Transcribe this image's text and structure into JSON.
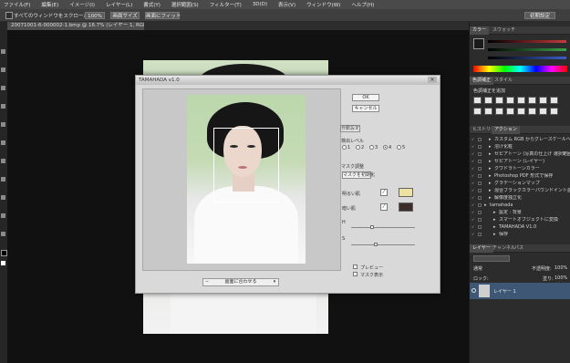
{
  "menu": [
    "ファイル(F)",
    "編集(E)",
    "イメージ(I)",
    "レイヤー(L)",
    "書式(Y)",
    "選択範囲(S)",
    "フィルター(T)",
    "3D(D)",
    "表示(V)",
    "ウィンドウ(W)",
    "ヘルプ(H)"
  ],
  "options": {
    "scroll_all": "すべてのウィンドウをスクロール",
    "zoom_100": "100%",
    "actual_pixels": "画面サイズ",
    "fit_screen": "画面にフィット",
    "workspace": "初期設定"
  },
  "document_tab": "20071001-6-000002-1.bmp @ 16.7% (レイヤー 1, RGB/8) *",
  "dialog": {
    "title": "TAMAHADA v1.0",
    "ok": "OK",
    "cancel": "キャンセル",
    "auto_set": "自動設定",
    "detect_level_label": "検出レベル",
    "detect_levels": [
      "1",
      "2",
      "3",
      "4",
      "5"
    ],
    "detect_selected_index": 3,
    "mask_adjust_label": "マスク調整",
    "mask_adjust_button": "マスクを初期化",
    "bright_label": "明るい肌",
    "dark_label": "暗い肌",
    "bright_color": "#ede2a1",
    "dark_color": "#3d2d2a",
    "h_label": "H",
    "s_label": "S",
    "preview_label": "プレビュー",
    "mask_display_label": "マスク表示",
    "zoom_combo": "画面に合わせる",
    "h_value_fraction": 0.3,
    "s_value_fraction": 0.35
  },
  "right_panel": {
    "color_tabs": [
      "カラー",
      "スウォッチ"
    ],
    "adjust_tabs": [
      "色調補正",
      "スタイル"
    ],
    "adjust_heading": "色調補正を追加",
    "history_tabs": [
      "ヒストリー",
      "アクション"
    ],
    "actions": [
      {
        "label": "カスタム RGB からグレースケールへ",
        "indent": 1
      },
      {
        "label": "溶け化粧",
        "indent": 1
      },
      {
        "label": "セピアトーン (写真の仕上げ 選択範囲)",
        "indent": 1
      },
      {
        "label": "セピアトーン (レイヤー)",
        "indent": 1
      },
      {
        "label": "クワドラトーンカラー",
        "indent": 1
      },
      {
        "label": "Photoshop PDF 形式で保存",
        "indent": 1
      },
      {
        "label": "グラデーションマップ",
        "indent": 1
      },
      {
        "label": "混合ブラックカラーパウンドイント設定",
        "indent": 1
      },
      {
        "label": "解像度独立化",
        "indent": 1
      },
      {
        "label": "tamahada",
        "indent": 0
      },
      {
        "label": "設定 : 背景",
        "indent": 2
      },
      {
        "label": "スマートオブジェクトに変換",
        "indent": 2
      },
      {
        "label": "TAMAHADA V1.0",
        "indent": 2
      },
      {
        "label": "保存",
        "indent": 2
      }
    ],
    "layers_tabs": [
      "レイヤー",
      "チャンネル",
      "パス"
    ],
    "blend_mode": "通常",
    "opacity_label": "不透明度:",
    "opacity_value": "100%",
    "lock_label": "ロック:",
    "fill_label": "塗り:",
    "fill_value": "100%",
    "layer_name": "レイヤー 1",
    "colors": {
      "red": "#c8393b",
      "green": "#3aa14a",
      "blue": "#3a5ec8",
      "layer_selected": "#3d5774"
    }
  }
}
